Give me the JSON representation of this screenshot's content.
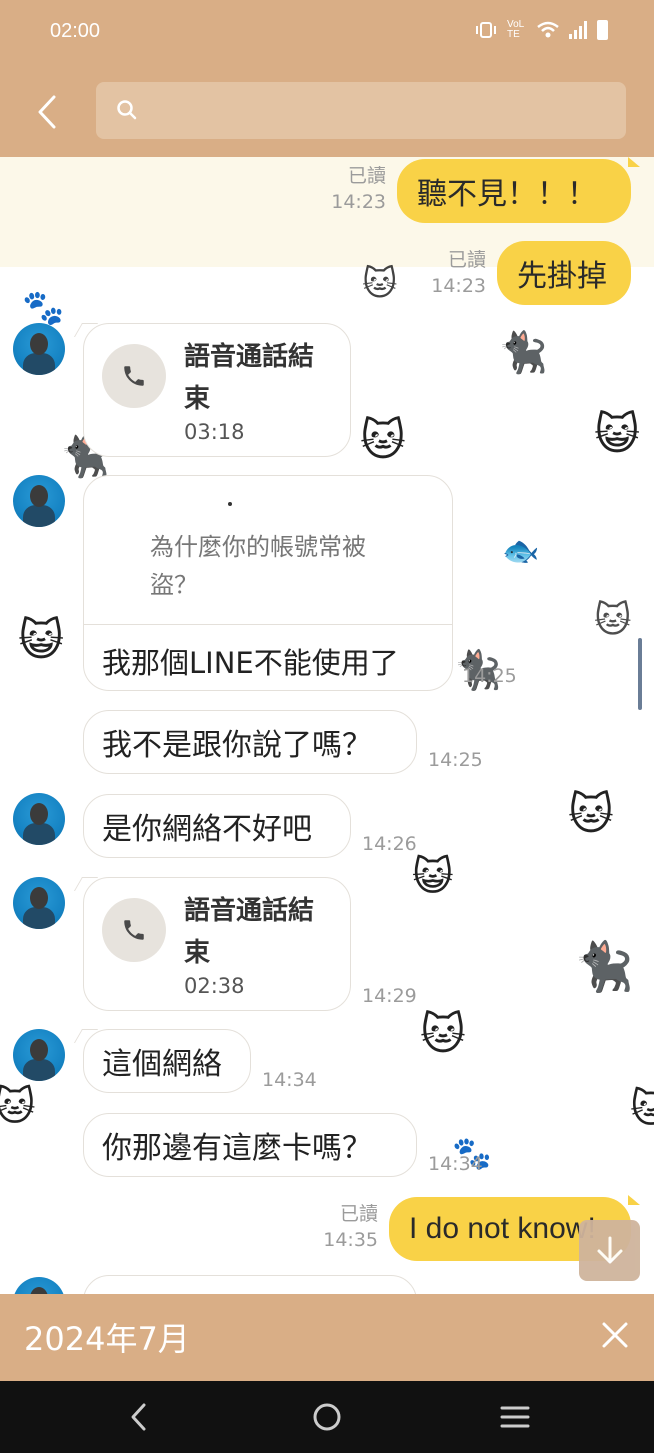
{
  "status_bar": {
    "time": "02:00",
    "network": "VoLTE"
  },
  "header": {
    "search_placeholder": ""
  },
  "messages": [
    {
      "direction": "out",
      "text": "聽不見！！！",
      "read": "已讀",
      "time": "14:23"
    },
    {
      "direction": "out",
      "text": "先掛掉",
      "read": "已讀",
      "time": "14:23"
    },
    {
      "direction": "in",
      "type": "call",
      "title": "語音通話結束",
      "duration": "03:18"
    },
    {
      "direction": "in",
      "type": "reply",
      "quoted": "為什麼你的帳號常被盜？",
      "text": "我那個LINE不能使用了",
      "time": "14:25"
    },
    {
      "direction": "in",
      "text": "我不是跟你說了嗎？",
      "time": "14:25"
    },
    {
      "direction": "in",
      "text": "是你網絡不好吧",
      "time": "14:26"
    },
    {
      "direction": "in",
      "type": "call",
      "title": "語音通話結束",
      "duration": "02:38",
      "time": "14:29"
    },
    {
      "direction": "in",
      "text": "這個網絡",
      "time": "14:34"
    },
    {
      "direction": "in",
      "text": "你那邊有這麼卡嗎？",
      "time": "14:34"
    },
    {
      "direction": "out",
      "text": "I do not know!",
      "read": "已讀",
      "time": "14:35"
    }
  ],
  "date_banner": {
    "label": "2024年7月"
  },
  "icons": {
    "back": "back-arrow-icon",
    "search": "search-icon",
    "call": "phone-icon",
    "scroll_down": "arrow-down-icon",
    "close": "close-icon"
  },
  "colors": {
    "header_bg": "#d9ae86",
    "outgoing_bubble": "#f9d247",
    "incoming_bubble": "#ffffff",
    "nav_bg": "#111111"
  }
}
